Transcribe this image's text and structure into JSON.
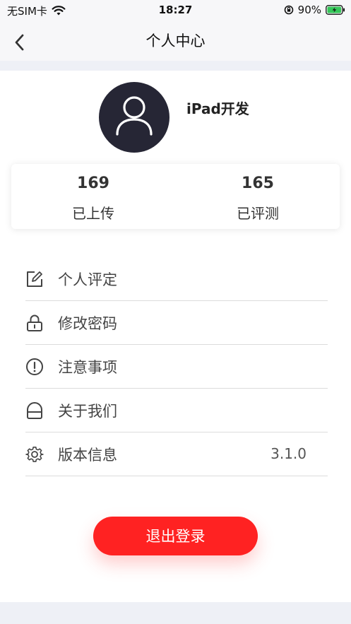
{
  "status_bar": {
    "carrier": "无SIM卡",
    "time": "18:27",
    "battery": "90%"
  },
  "nav": {
    "title": "个人中心"
  },
  "profile": {
    "username": "iPad开发"
  },
  "stats": [
    {
      "value": "169",
      "label": "已上传"
    },
    {
      "value": "165",
      "label": "已评测"
    }
  ],
  "menu": [
    {
      "label": "个人评定",
      "icon": "edit-icon"
    },
    {
      "label": "修改密码",
      "icon": "lock-icon"
    },
    {
      "label": "注意事项",
      "icon": "alert-icon"
    },
    {
      "label": "关于我们",
      "icon": "about-icon"
    },
    {
      "label": "版本信息",
      "icon": "settings-icon",
      "value": "3.1.0"
    }
  ],
  "logout_label": "退出登录",
  "colors": {
    "accent": "#ff2222",
    "avatar_bg": "#262635",
    "page_band": "#eef0f6"
  }
}
